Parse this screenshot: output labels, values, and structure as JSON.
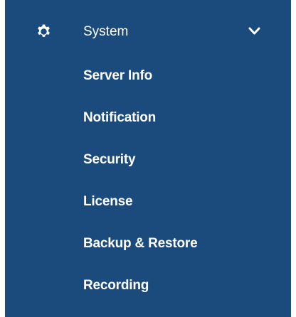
{
  "sidebar": {
    "background": "#1b4a7c",
    "header": {
      "icon": "gear-icon",
      "label": "System",
      "expand_icon": "chevron-down-icon",
      "expanded": true
    },
    "items": [
      {
        "label": "Server Info"
      },
      {
        "label": "Notification"
      },
      {
        "label": "Security"
      },
      {
        "label": "License"
      },
      {
        "label": "Backup & Restore"
      },
      {
        "label": "Recording"
      }
    ]
  }
}
